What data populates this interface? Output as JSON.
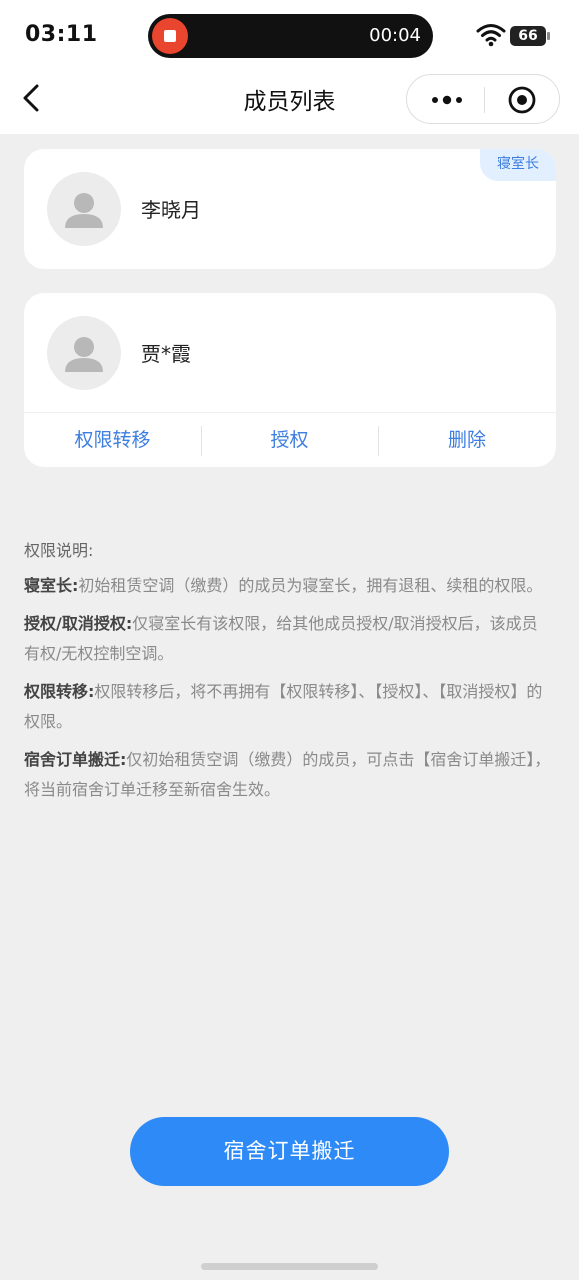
{
  "status_bar": {
    "time": "03:11",
    "recording_time": "00:04",
    "battery": "66"
  },
  "nav": {
    "title": "成员列表"
  },
  "members": [
    {
      "name": "李晓月",
      "badge": "寝室长"
    },
    {
      "name": "贾*霞",
      "actions": [
        "权限转移",
        "授权",
        "删除"
      ]
    }
  ],
  "rules": {
    "title": "权限说明:",
    "items": [
      {
        "label": "寝室长:",
        "text": "初始租赁空调（缴费）的成员为寝室长，拥有退租、续租的权限。"
      },
      {
        "label": "授权/取消授权:",
        "text": "仅寝室长有该权限，给其他成员授权/取消授权后，该成员有权/无权控制空调。"
      },
      {
        "label": "权限转移:",
        "text": "权限转移后，将不再拥有【权限转移】、【授权】、【取消授权】的权限。"
      },
      {
        "label": "宿舍订单搬迁:",
        "text": "仅初始租赁空调（缴费）的成员，可点击【宿舍订单搬迁】，将当前宿舍订单迁移至新宿舍生效。"
      }
    ]
  },
  "bottom_button": {
    "label": "宿舍订单搬迁"
  },
  "colors": {
    "primary": "#2e8af6",
    "link": "#3d7ee0",
    "badge_bg": "#e2efff",
    "background": "#efefef",
    "record": "#e9452f"
  }
}
